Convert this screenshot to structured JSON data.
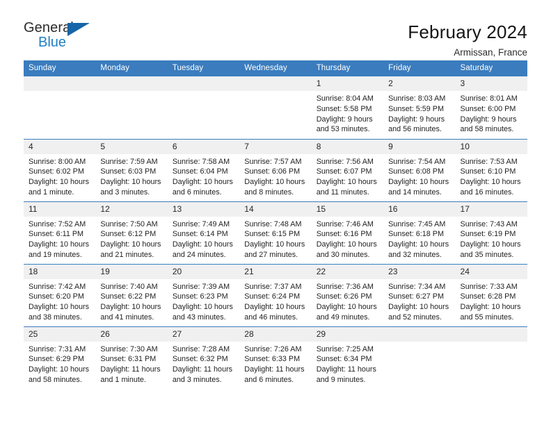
{
  "logo": {
    "primary_text": "General",
    "secondary_text": "Blue",
    "triangle_icon": "triangle-icon",
    "primary_color": "#2b2b2b",
    "secondary_color": "#1f7fc4",
    "triangle_color": "#1565a8"
  },
  "header": {
    "title": "February 2024",
    "subtitle": "Armissan, France"
  },
  "theme": {
    "header_bg": "#3a7cbe",
    "header_text": "#ffffff",
    "daynum_bg": "#f0f0f0",
    "cell_bg": "#ffffff",
    "separator": "#3a7cbe"
  },
  "calendar": {
    "columns": [
      "Sunday",
      "Monday",
      "Tuesday",
      "Wednesday",
      "Thursday",
      "Friday",
      "Saturday"
    ],
    "weeks": [
      [
        {
          "day": "",
          "sunrise": "",
          "sunset": "",
          "daylight": "",
          "daylight2": ""
        },
        {
          "day": "",
          "sunrise": "",
          "sunset": "",
          "daylight": "",
          "daylight2": ""
        },
        {
          "day": "",
          "sunrise": "",
          "sunset": "",
          "daylight": "",
          "daylight2": ""
        },
        {
          "day": "",
          "sunrise": "",
          "sunset": "",
          "daylight": "",
          "daylight2": ""
        },
        {
          "day": "1",
          "sunrise": "Sunrise: 8:04 AM",
          "sunset": "Sunset: 5:58 PM",
          "daylight": "Daylight: 9 hours",
          "daylight2": "and 53 minutes."
        },
        {
          "day": "2",
          "sunrise": "Sunrise: 8:03 AM",
          "sunset": "Sunset: 5:59 PM",
          "daylight": "Daylight: 9 hours",
          "daylight2": "and 56 minutes."
        },
        {
          "day": "3",
          "sunrise": "Sunrise: 8:01 AM",
          "sunset": "Sunset: 6:00 PM",
          "daylight": "Daylight: 9 hours",
          "daylight2": "and 58 minutes."
        }
      ],
      [
        {
          "day": "4",
          "sunrise": "Sunrise: 8:00 AM",
          "sunset": "Sunset: 6:02 PM",
          "daylight": "Daylight: 10 hours",
          "daylight2": "and 1 minute."
        },
        {
          "day": "5",
          "sunrise": "Sunrise: 7:59 AM",
          "sunset": "Sunset: 6:03 PM",
          "daylight": "Daylight: 10 hours",
          "daylight2": "and 3 minutes."
        },
        {
          "day": "6",
          "sunrise": "Sunrise: 7:58 AM",
          "sunset": "Sunset: 6:04 PM",
          "daylight": "Daylight: 10 hours",
          "daylight2": "and 6 minutes."
        },
        {
          "day": "7",
          "sunrise": "Sunrise: 7:57 AM",
          "sunset": "Sunset: 6:06 PM",
          "daylight": "Daylight: 10 hours",
          "daylight2": "and 8 minutes."
        },
        {
          "day": "8",
          "sunrise": "Sunrise: 7:56 AM",
          "sunset": "Sunset: 6:07 PM",
          "daylight": "Daylight: 10 hours",
          "daylight2": "and 11 minutes."
        },
        {
          "day": "9",
          "sunrise": "Sunrise: 7:54 AM",
          "sunset": "Sunset: 6:08 PM",
          "daylight": "Daylight: 10 hours",
          "daylight2": "and 14 minutes."
        },
        {
          "day": "10",
          "sunrise": "Sunrise: 7:53 AM",
          "sunset": "Sunset: 6:10 PM",
          "daylight": "Daylight: 10 hours",
          "daylight2": "and 16 minutes."
        }
      ],
      [
        {
          "day": "11",
          "sunrise": "Sunrise: 7:52 AM",
          "sunset": "Sunset: 6:11 PM",
          "daylight": "Daylight: 10 hours",
          "daylight2": "and 19 minutes."
        },
        {
          "day": "12",
          "sunrise": "Sunrise: 7:50 AM",
          "sunset": "Sunset: 6:12 PM",
          "daylight": "Daylight: 10 hours",
          "daylight2": "and 21 minutes."
        },
        {
          "day": "13",
          "sunrise": "Sunrise: 7:49 AM",
          "sunset": "Sunset: 6:14 PM",
          "daylight": "Daylight: 10 hours",
          "daylight2": "and 24 minutes."
        },
        {
          "day": "14",
          "sunrise": "Sunrise: 7:48 AM",
          "sunset": "Sunset: 6:15 PM",
          "daylight": "Daylight: 10 hours",
          "daylight2": "and 27 minutes."
        },
        {
          "day": "15",
          "sunrise": "Sunrise: 7:46 AM",
          "sunset": "Sunset: 6:16 PM",
          "daylight": "Daylight: 10 hours",
          "daylight2": "and 30 minutes."
        },
        {
          "day": "16",
          "sunrise": "Sunrise: 7:45 AM",
          "sunset": "Sunset: 6:18 PM",
          "daylight": "Daylight: 10 hours",
          "daylight2": "and 32 minutes."
        },
        {
          "day": "17",
          "sunrise": "Sunrise: 7:43 AM",
          "sunset": "Sunset: 6:19 PM",
          "daylight": "Daylight: 10 hours",
          "daylight2": "and 35 minutes."
        }
      ],
      [
        {
          "day": "18",
          "sunrise": "Sunrise: 7:42 AM",
          "sunset": "Sunset: 6:20 PM",
          "daylight": "Daylight: 10 hours",
          "daylight2": "and 38 minutes."
        },
        {
          "day": "19",
          "sunrise": "Sunrise: 7:40 AM",
          "sunset": "Sunset: 6:22 PM",
          "daylight": "Daylight: 10 hours",
          "daylight2": "and 41 minutes."
        },
        {
          "day": "20",
          "sunrise": "Sunrise: 7:39 AM",
          "sunset": "Sunset: 6:23 PM",
          "daylight": "Daylight: 10 hours",
          "daylight2": "and 43 minutes."
        },
        {
          "day": "21",
          "sunrise": "Sunrise: 7:37 AM",
          "sunset": "Sunset: 6:24 PM",
          "daylight": "Daylight: 10 hours",
          "daylight2": "and 46 minutes."
        },
        {
          "day": "22",
          "sunrise": "Sunrise: 7:36 AM",
          "sunset": "Sunset: 6:26 PM",
          "daylight": "Daylight: 10 hours",
          "daylight2": "and 49 minutes."
        },
        {
          "day": "23",
          "sunrise": "Sunrise: 7:34 AM",
          "sunset": "Sunset: 6:27 PM",
          "daylight": "Daylight: 10 hours",
          "daylight2": "and 52 minutes."
        },
        {
          "day": "24",
          "sunrise": "Sunrise: 7:33 AM",
          "sunset": "Sunset: 6:28 PM",
          "daylight": "Daylight: 10 hours",
          "daylight2": "and 55 minutes."
        }
      ],
      [
        {
          "day": "25",
          "sunrise": "Sunrise: 7:31 AM",
          "sunset": "Sunset: 6:29 PM",
          "daylight": "Daylight: 10 hours",
          "daylight2": "and 58 minutes."
        },
        {
          "day": "26",
          "sunrise": "Sunrise: 7:30 AM",
          "sunset": "Sunset: 6:31 PM",
          "daylight": "Daylight: 11 hours",
          "daylight2": "and 1 minute."
        },
        {
          "day": "27",
          "sunrise": "Sunrise: 7:28 AM",
          "sunset": "Sunset: 6:32 PM",
          "daylight": "Daylight: 11 hours",
          "daylight2": "and 3 minutes."
        },
        {
          "day": "28",
          "sunrise": "Sunrise: 7:26 AM",
          "sunset": "Sunset: 6:33 PM",
          "daylight": "Daylight: 11 hours",
          "daylight2": "and 6 minutes."
        },
        {
          "day": "29",
          "sunrise": "Sunrise: 7:25 AM",
          "sunset": "Sunset: 6:34 PM",
          "daylight": "Daylight: 11 hours",
          "daylight2": "and 9 minutes."
        },
        {
          "day": "",
          "sunrise": "",
          "sunset": "",
          "daylight": "",
          "daylight2": ""
        },
        {
          "day": "",
          "sunrise": "",
          "sunset": "",
          "daylight": "",
          "daylight2": ""
        }
      ]
    ]
  }
}
